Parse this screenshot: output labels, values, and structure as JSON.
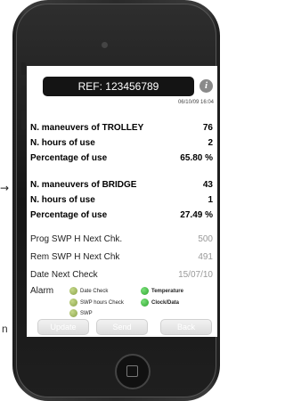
{
  "side": {
    "arrow": "→",
    "letter": "n"
  },
  "screen": {
    "ref": "REF: 123456789",
    "info_icon": "i",
    "datetime": "06/10/09 16:04",
    "trolley": [
      {
        "label": "N. maneuvers of TROLLEY",
        "value": "76"
      },
      {
        "label": "N. hours of use",
        "value": "2"
      },
      {
        "label": "Percentage of use",
        "value": "65.80 %"
      }
    ],
    "bridge": [
      {
        "label": "N. maneuvers of BRIDGE",
        "value": "43"
      },
      {
        "label": "N. hours of use",
        "value": "1"
      },
      {
        "label": "Percentage of use",
        "value": "27.49 %"
      }
    ],
    "checks": [
      {
        "label": "Prog SWP H Next Chk.",
        "value": "500"
      },
      {
        "label": "Rem SWP H Next Chk",
        "value": "491"
      },
      {
        "label": "Date Next Check",
        "value": "15/07/10"
      }
    ],
    "alarm": {
      "label": "Alarm",
      "items": [
        {
          "label": "Date Check",
          "color": "#a6c060"
        },
        {
          "label": "Temperature",
          "color": "#3fbf3f"
        },
        {
          "label": "SWP hours Check",
          "color": "#a6c060"
        },
        {
          "label": "Clock/Data",
          "color": "#3fbf3f"
        },
        {
          "label": "SWP",
          "color": "#a6c060"
        }
      ]
    },
    "buttons": {
      "update": "Update",
      "send": "Send",
      "back": "Back"
    }
  }
}
